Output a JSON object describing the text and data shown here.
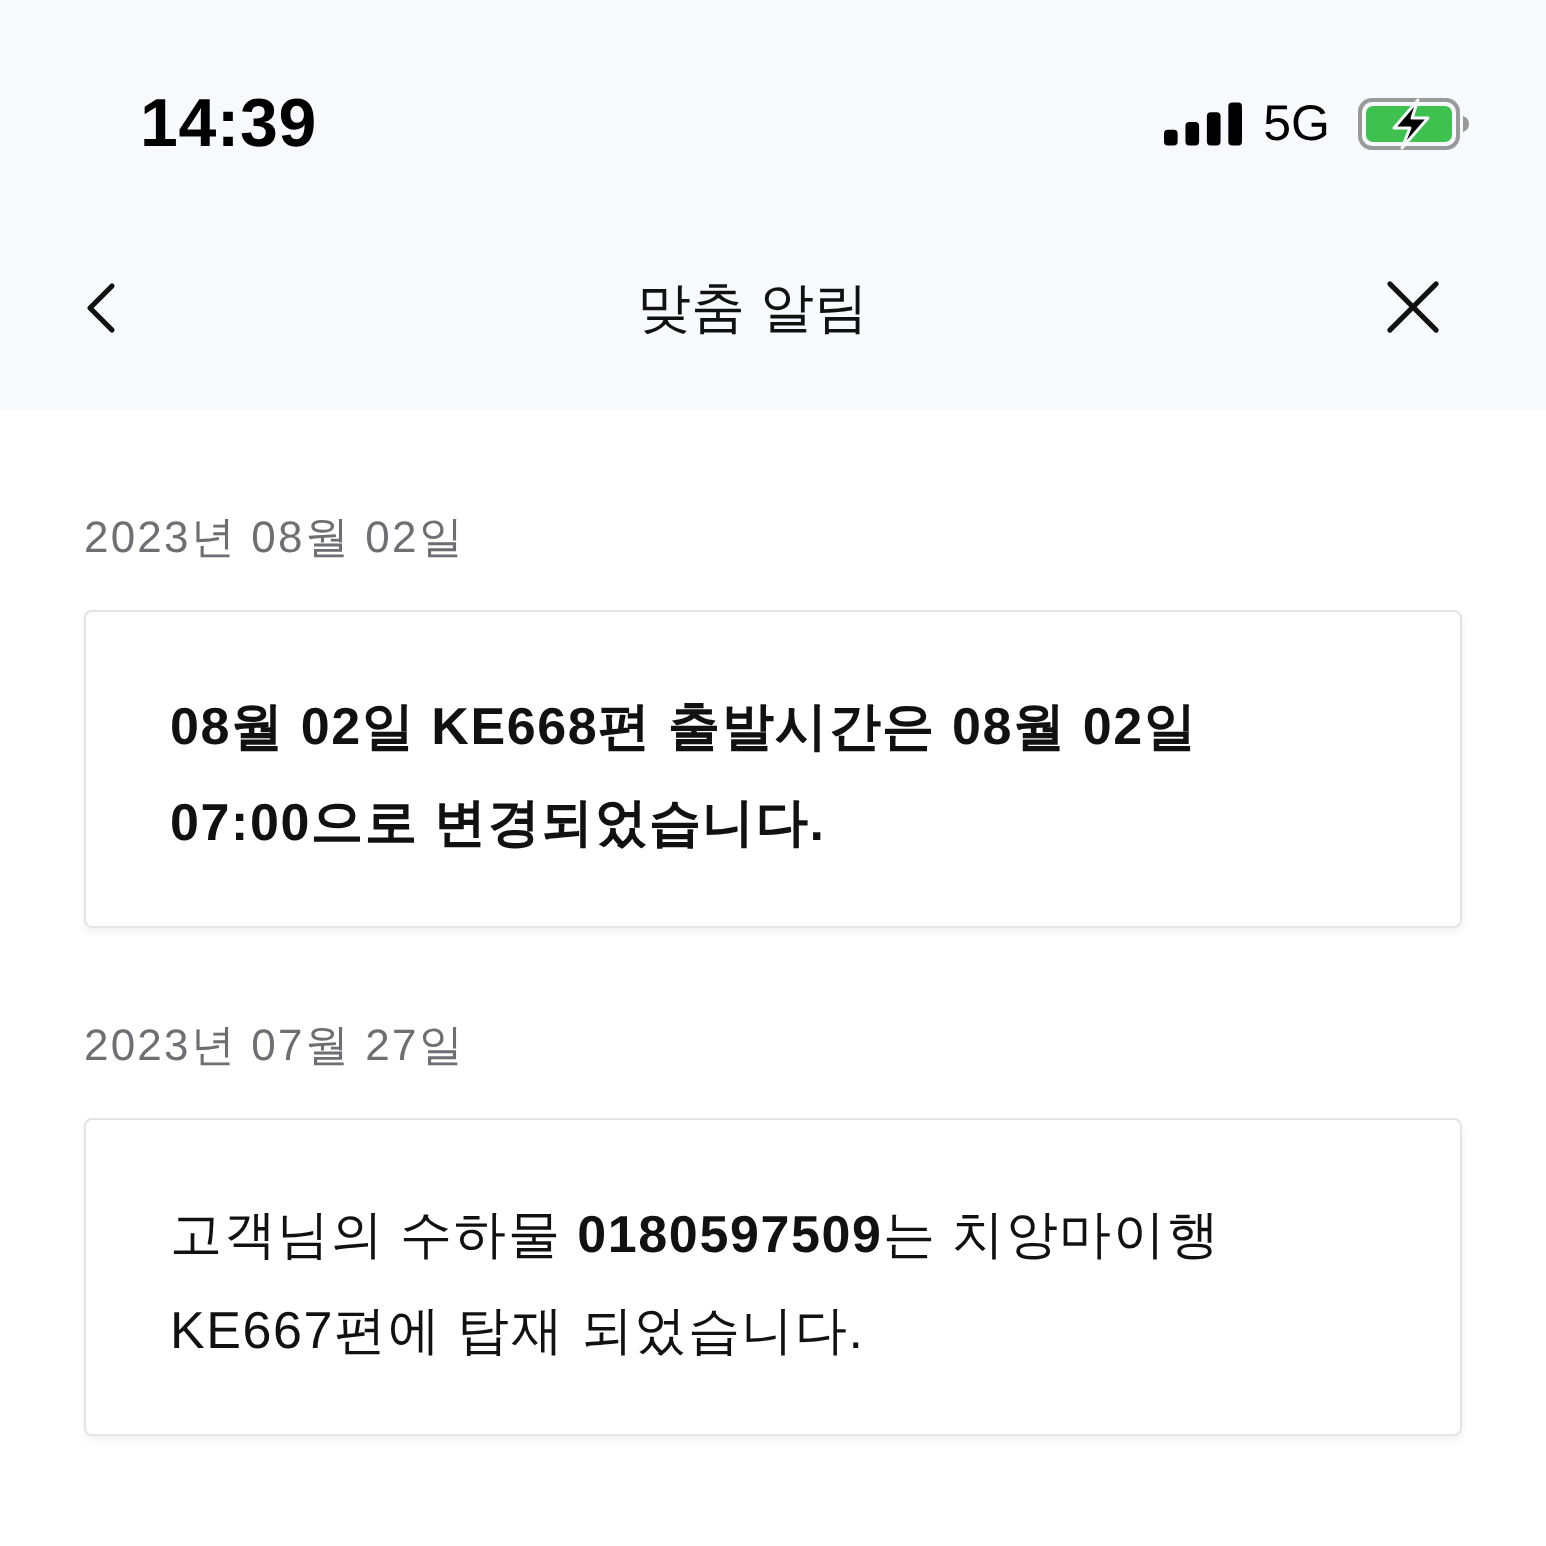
{
  "status_bar": {
    "time": "14:39",
    "network": "5G"
  },
  "nav": {
    "title": "맞춤 알림"
  },
  "notices": [
    {
      "date": "2023년 08월 02일",
      "message": "08월 02일 KE668편 출발시간은 08월 02일 07:00으로 변경되었습니다.",
      "bold": true
    },
    {
      "date": "2023년 07월 27일",
      "message": "고객님의 수하물 **0180597509**는 치앙마이행 KE667편에 탑재 되었습니다.",
      "bold": false
    }
  ]
}
